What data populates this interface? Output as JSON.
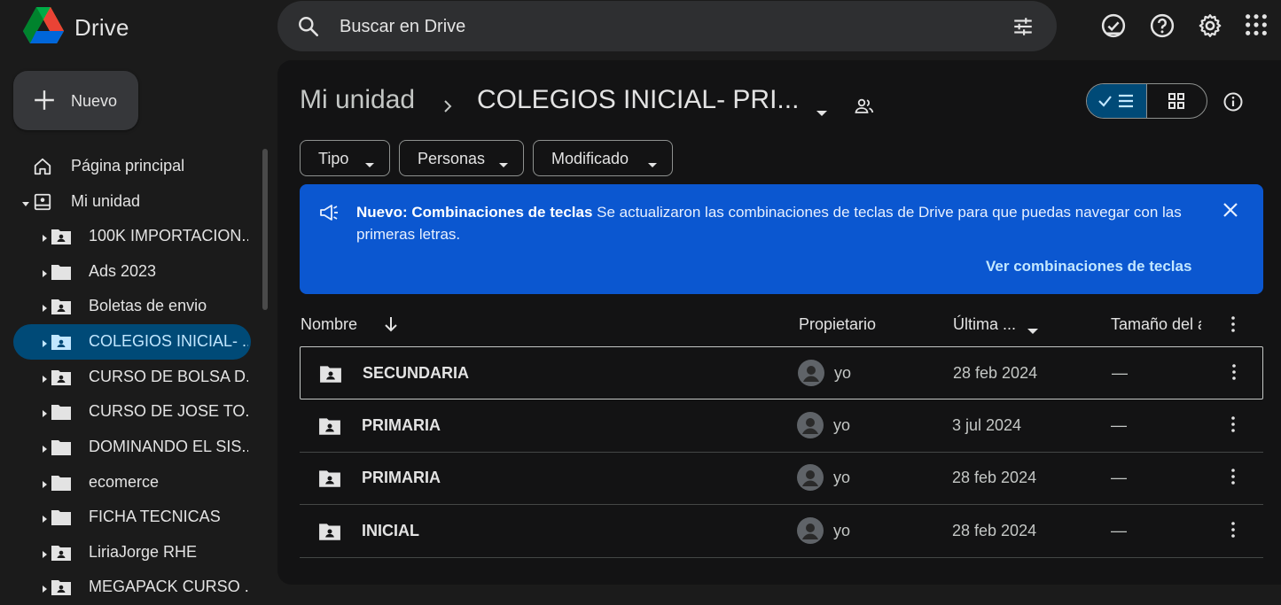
{
  "app": {
    "name": "Drive"
  },
  "search": {
    "placeholder": "Buscar en Drive"
  },
  "new_button": {
    "label": "Nuevo"
  },
  "sidebar": {
    "home": "Página principal",
    "my_drive": "Mi unidad",
    "folders": [
      {
        "label": "100K IMPORTACION...",
        "shared": true
      },
      {
        "label": "Ads 2023",
        "shared": false
      },
      {
        "label": "Boletas de envio",
        "shared": true
      },
      {
        "label": "COLEGIOS INICIAL- ...",
        "shared": true,
        "selected": true
      },
      {
        "label": "CURSO DE BOLSA D...",
        "shared": true
      },
      {
        "label": "CURSO DE JOSE TO...",
        "shared": false
      },
      {
        "label": "DOMINANDO EL SIS...",
        "shared": false
      },
      {
        "label": "ecomerce",
        "shared": false
      },
      {
        "label": "FICHA TECNICAS",
        "shared": false
      },
      {
        "label": "LiriaJorge RHE",
        "shared": true
      },
      {
        "label": "MEGAPACK CURSO ...",
        "shared": true
      }
    ]
  },
  "breadcrumb": {
    "root": "Mi unidad",
    "current": "COLEGIOS INICIAL- PRI..."
  },
  "filters": {
    "type": "Tipo",
    "people": "Personas",
    "modified": "Modificado"
  },
  "banner": {
    "title": "Nuevo: Combinaciones de teclas",
    "text": "Se actualizaron las combinaciones de teclas de Drive para que puedas navegar con las primeras letras.",
    "link": "Ver combinaciones de teclas"
  },
  "table": {
    "headers": {
      "name": "Nombre",
      "owner": "Propietario",
      "modified": "Última ...",
      "size": "Tamaño del a"
    },
    "rows": [
      {
        "name": "SECUNDARIA",
        "owner": "yo",
        "modified": "28 feb 2024",
        "size": "—"
      },
      {
        "name": "PRIMARIA",
        "owner": "yo",
        "modified": "3 jul 2024",
        "size": "—"
      },
      {
        "name": "PRIMARIA",
        "owner": "yo",
        "modified": "28 feb 2024",
        "size": "—"
      },
      {
        "name": "INICIAL",
        "owner": "yo",
        "modified": "28 feb 2024",
        "size": "—"
      }
    ]
  },
  "colors": {
    "accent": "#004a77",
    "banner": "#0b57d0",
    "background": "#1b1b1b",
    "surface": "#131314"
  }
}
